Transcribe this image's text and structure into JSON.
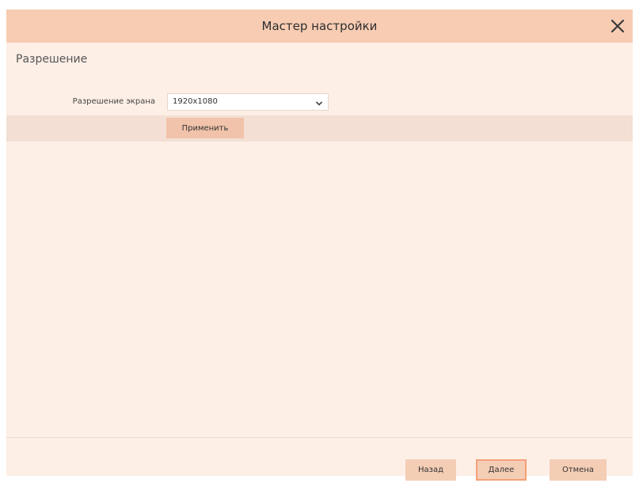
{
  "dialog": {
    "title": "Мастер настройки",
    "section_title": "Разрешение"
  },
  "form": {
    "resolution_label": "Разрешение экрана",
    "resolution_value": "1920x1080",
    "apply_label": "Применить"
  },
  "footer": {
    "back_label": "Назад",
    "next_label": "Далее",
    "cancel_label": "Отмена"
  },
  "icons": {
    "close": "close-icon",
    "dropdown": "chevron-down-icon"
  },
  "colors": {
    "titlebar": "#f7ccb3",
    "background": "#fdefe6",
    "button": "#f4cdb5",
    "accent_border": "#f5a07a"
  }
}
